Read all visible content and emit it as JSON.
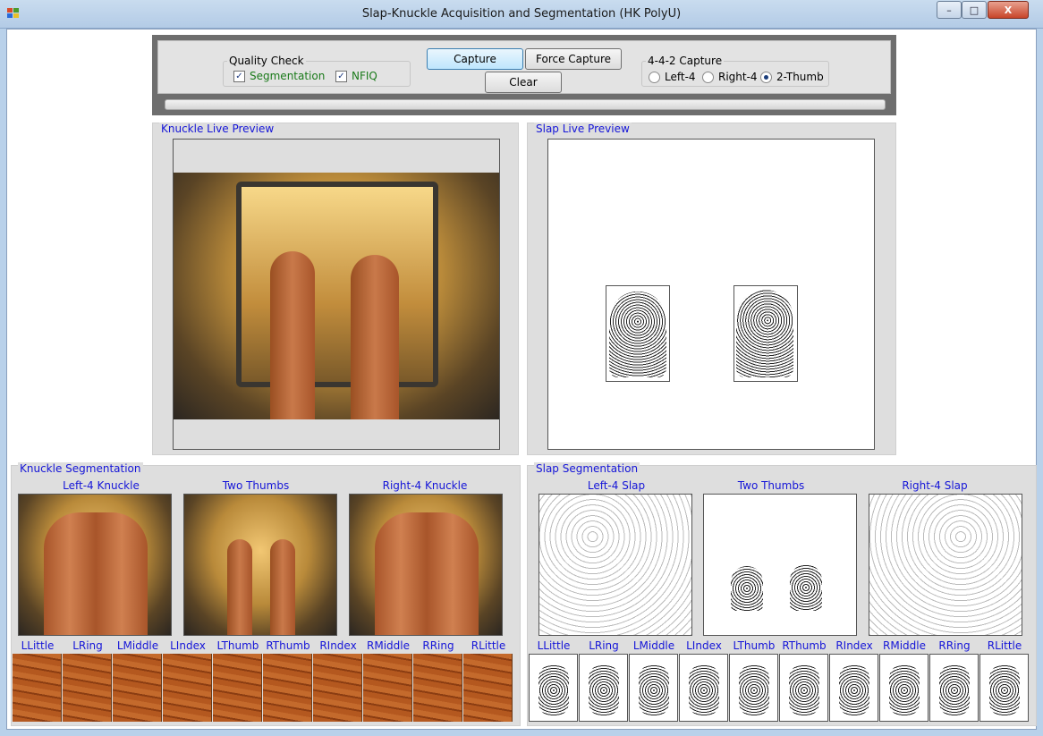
{
  "window": {
    "title": "Slap-Knuckle Acquisition and Segmentation (HK PolyU)",
    "minimize": "–",
    "maximize": "□",
    "close": "X"
  },
  "toolbar": {
    "quality_check": {
      "legend": "Quality Check",
      "segmentation_label": "Segmentation",
      "segmentation_checked": true,
      "nfiq_label": "NFIQ",
      "nfiq_checked": true,
      "check_mark": "✓"
    },
    "capture_label": "Capture",
    "force_capture_label": "Force Capture",
    "clear_label": "Clear",
    "capture_mode": {
      "legend": "4-4-2 Capture",
      "options": [
        "Left-4",
        "Right-4",
        "2-Thumb"
      ],
      "selected": "2-Thumb"
    }
  },
  "knuckle_live": {
    "label": "Knuckle Live Preview"
  },
  "slap_live": {
    "label": "Slap Live Preview"
  },
  "knuckle_seg": {
    "label": "Knuckle Segmentation",
    "groups": [
      "Left-4 Knuckle",
      "Two Thumbs",
      "Right-4 Knuckle"
    ],
    "fingers": [
      "LLittle",
      "LRing",
      "LMiddle",
      "LIndex",
      "LThumb",
      "RThumb",
      "RIndex",
      "RMiddle",
      "RRing",
      "RLittle"
    ]
  },
  "slap_seg": {
    "label": "Slap Segmentation",
    "groups": [
      "Left-4 Slap",
      "Two Thumbs",
      "Right-4 Slap"
    ],
    "fingers": [
      "LLittle",
      "LRing",
      "LMiddle",
      "LIndex",
      "LThumb",
      "RThumb",
      "RIndex",
      "RMiddle",
      "RRing",
      "RLittle"
    ]
  },
  "colors": {
    "label_blue": "#1515d8",
    "check_green": "#1a7a1a",
    "panel_gray": "#dedede",
    "skin": "#b4581f"
  }
}
